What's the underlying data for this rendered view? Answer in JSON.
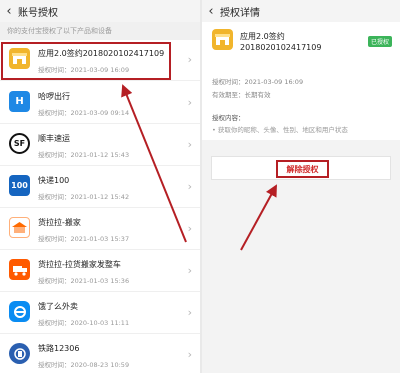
{
  "left": {
    "title": "账号授权",
    "note": "你的支付宝授权了以下产品和设备",
    "apps": [
      {
        "name": "应用2.0签约2018020102417109",
        "time": "授权时间：2021-03-09 16:09",
        "icon": "shop-icon",
        "color": "#f1b52c"
      },
      {
        "name": "哈啰出行",
        "time": "授权时间：2021-03-09 09:14",
        "icon": "hello-bike-icon",
        "color": "#1e88e5"
      },
      {
        "name": "顺丰速运",
        "time": "授权时间：2021-01-12 15:43",
        "icon": "sf-express-icon",
        "color": "#111111"
      },
      {
        "name": "快递100",
        "time": "授权时间：2021-01-12 15:42",
        "icon": "kuaidi100-icon",
        "color": "#1565c0"
      },
      {
        "name": "货拉拉-搬家",
        "time": "授权时间：2021-01-03 15:37",
        "icon": "huolala-move-icon",
        "color": "#ff6a00"
      },
      {
        "name": "货拉拉-拉货搬家发整车",
        "time": "授权时间：2021-01-03 15:36",
        "icon": "huolala-truck-icon",
        "color": "#ff5a00"
      },
      {
        "name": "饿了么外卖",
        "time": "授权时间：2020-10-03 11:11",
        "icon": "eleme-icon",
        "color": "#0a8cf2"
      },
      {
        "name": "铁路12306",
        "time": "授权时间：2020-08-23 10:59",
        "icon": "railway-12306-icon",
        "color": "#2a5fb0"
      }
    ]
  },
  "right": {
    "title": "授权详情",
    "app_name": "应用2.0签约",
    "app_id": "2018020102417109",
    "badge": "已授权",
    "badge_color": "#3cb45a",
    "auth_time": "授权时间：2021-03-09 16:09",
    "valid_period": "有效期至：长期有效",
    "content_label": "授权内容：",
    "content_item": "获取你的昵称、头像、性别、地区和用户状态",
    "revoke": "解除授权"
  },
  "annotation_color": "#b51f24"
}
